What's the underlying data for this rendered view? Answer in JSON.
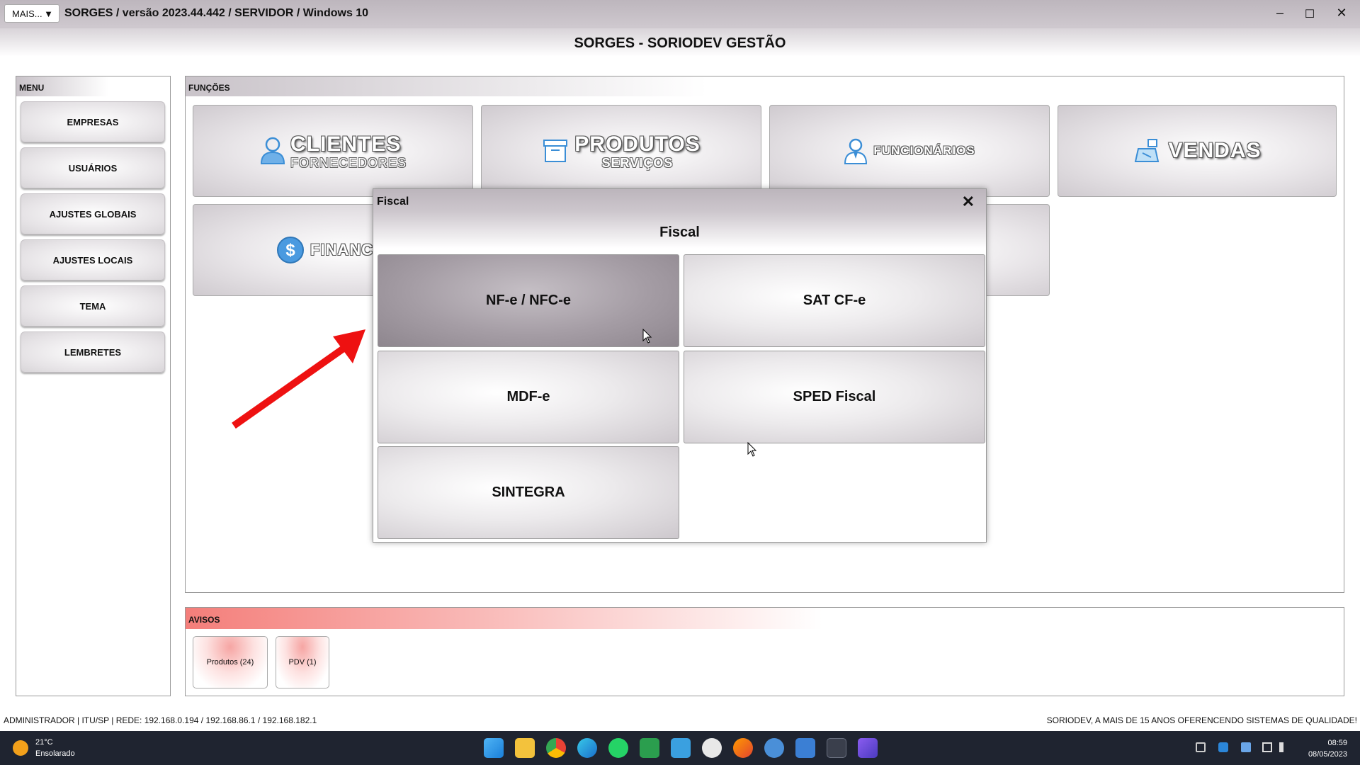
{
  "window": {
    "mais_label": "MAIS...",
    "title": "SORGES / versão 2023.44.442 / SERVIDOR / Windows 10",
    "minimize": "–",
    "maximize": "☐",
    "close": "✕"
  },
  "header": {
    "title": "SORGES - SORIODEV GESTÃO"
  },
  "menu": {
    "label": "MENU",
    "items": [
      "EMPRESAS",
      "USUÁRIOS",
      "AJUSTES GLOBAIS",
      "AJUSTES LOCAIS",
      "TEMA",
      "LEMBRETES"
    ]
  },
  "functions": {
    "label": "FUNÇÕES",
    "clientes": {
      "title": "CLIENTES",
      "subtitle": "FORNECEDORES",
      "icon": "person-icon"
    },
    "produtos": {
      "title": "PRODUTOS",
      "subtitle": "SERVIÇOS",
      "icon": "box-icon"
    },
    "funcionarios": {
      "title": "FUNCIONÁRIOS",
      "icon": "employee-icon"
    },
    "vendas": {
      "title": "VENDAS",
      "icon": "cash-register-icon"
    },
    "financeiro": {
      "title": "FINANCEI",
      "icon": "dollar-icon"
    }
  },
  "avisos": {
    "label": "AVISOS",
    "items": [
      "Produtos (24)",
      "PDV (1)"
    ]
  },
  "footer": {
    "left": "ADMINISTRADOR |   ITU/SP |   REDE: 192.168.0.194 / 192.168.86.1 / 192.168.182.1",
    "right": "SORIODEV, A MAIS DE 15 ANOS OFERENCENDO SISTEMAS DE QUALIDADE!"
  },
  "modal": {
    "window_title": "Fiscal",
    "heading": "Fiscal",
    "close": "✕",
    "buttons": [
      "NF-e / NFC-e",
      "SAT CF-e",
      "MDF-e",
      "SPED Fiscal",
      "SINTEGRA"
    ]
  },
  "taskbar": {
    "temperature": "21°C",
    "weather": "Ensolarado",
    "time": "08:59",
    "date": "08/05/2023"
  },
  "colors": {
    "arrow": "#ee1111",
    "avisos_accent": "#f47e7a",
    "taskbar": "#1f2430"
  }
}
